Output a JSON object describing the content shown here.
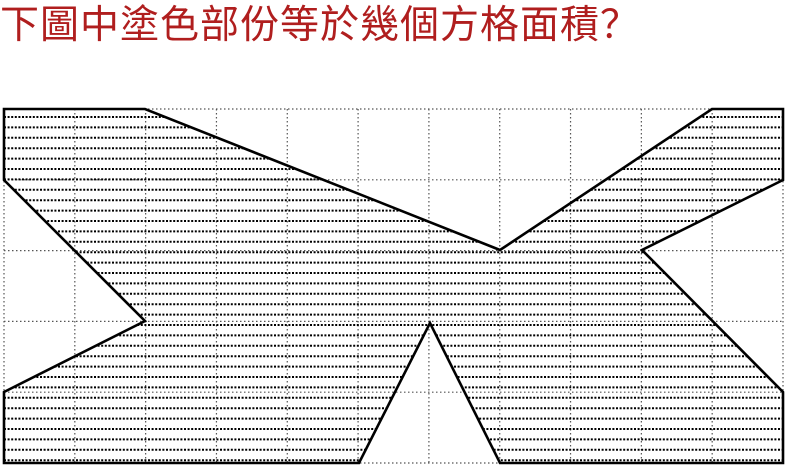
{
  "question": {
    "text": "下圖中塗色部份等於幾個方格面積？",
    "color": "#b01e1e"
  },
  "figure": {
    "grid_columns": 11,
    "grid_rows": 5,
    "shaded_region": "hatched",
    "hatch_style": "horizontal-dotted-lines",
    "outline_color": "#000000",
    "grid_line_style": "dotted"
  }
}
